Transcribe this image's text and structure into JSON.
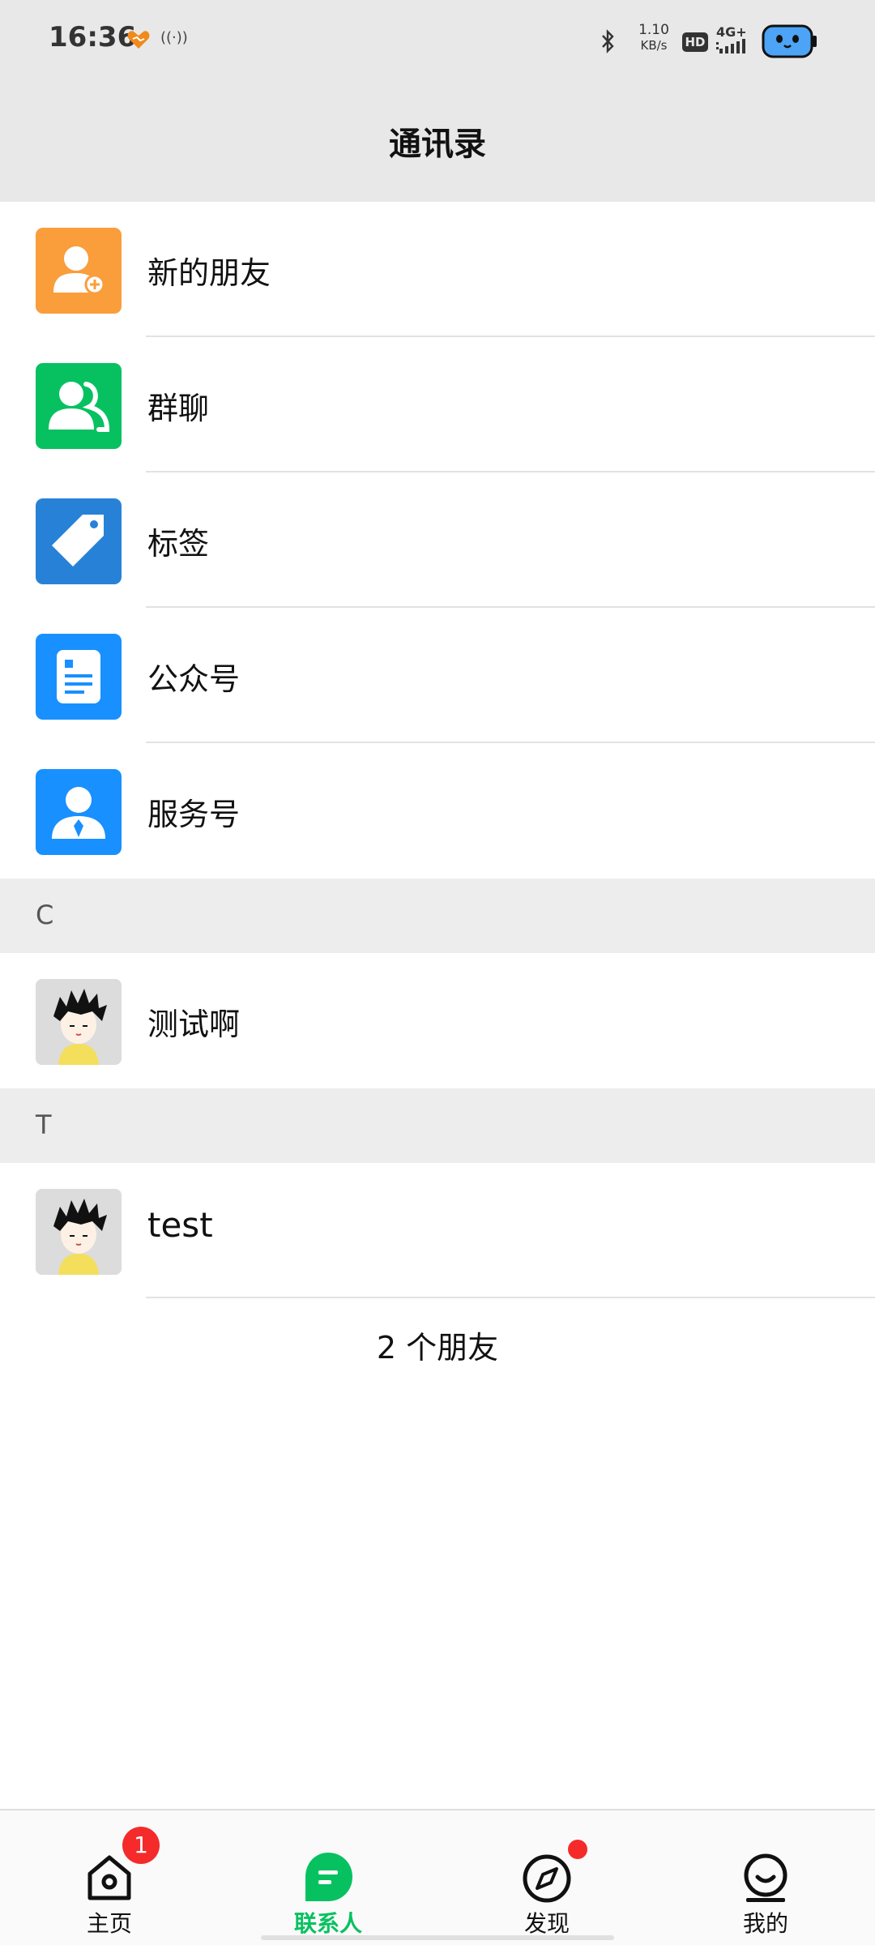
{
  "status_bar": {
    "time": "16:36",
    "network_speed_value": "1.10",
    "network_speed_unit": "KB/s",
    "hd_label": "HD",
    "cell_label": "4G+"
  },
  "header": {
    "title": "通讯录"
  },
  "menu": [
    {
      "label": "新的朋友",
      "icon": "add-friend-icon",
      "color": "#fa9d3b"
    },
    {
      "label": "群聊",
      "icon": "group-chat-icon",
      "color": "#07c160"
    },
    {
      "label": "标签",
      "icon": "tag-icon",
      "color": "#2782d7"
    },
    {
      "label": "公众号",
      "icon": "official-account-icon",
      "color": "#1890ff"
    },
    {
      "label": "服务号",
      "icon": "service-account-icon",
      "color": "#1890ff"
    }
  ],
  "sections": [
    {
      "letter": "C",
      "contacts": [
        {
          "name": "测试啊",
          "icon": "avatar-image"
        }
      ]
    },
    {
      "letter": "T",
      "contacts": [
        {
          "name": "test",
          "icon": "avatar-image"
        }
      ]
    }
  ],
  "friend_count": "2 个朋友",
  "tabs": [
    {
      "label": "主页",
      "icon": "home-icon",
      "badge": "1"
    },
    {
      "label": "联系人",
      "icon": "contacts-icon",
      "active": true
    },
    {
      "label": "发现",
      "icon": "compass-icon",
      "dot": true
    },
    {
      "label": "我的",
      "icon": "profile-icon"
    }
  ],
  "colors": {
    "accent": "#07c160",
    "badge": "#f52b2b",
    "header_bg": "#e8e8e8"
  }
}
